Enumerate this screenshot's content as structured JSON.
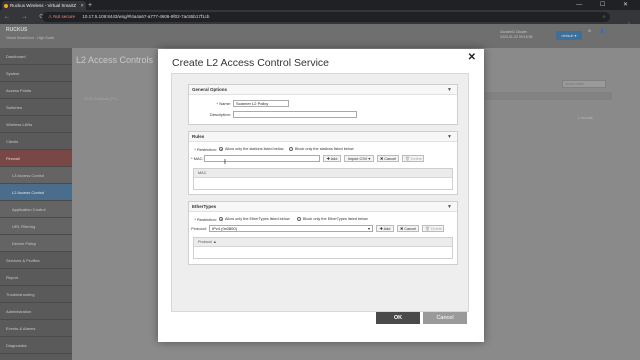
{
  "browser": {
    "tab_title": "Ruckus Wireless - Virtual SmartZ",
    "new_tab": "+",
    "window_controls": "— ☐ ✕",
    "nav": "← → ⟳",
    "not_secure": "⚠ Not secure",
    "url": "10.17.5.109:8443/wsg/#l4a4a67-a777-4606-9f02-7ac55b17f1cb"
  },
  "app": {
    "logo": "RUCKUS",
    "logo_sub": "Virtual SmartZone - High Scale",
    "cluster_lines": [
      "Cluster01 Cluster",
      "2020-01-22 09:16:35"
    ],
    "default_button": "default ▾",
    "header_icons": "⚙ 👤",
    "page_title": "L2 Access Controls",
    "search_placeholder": "search table",
    "tree_label": "SOS Controls (??)",
    "record_count": "1 records"
  },
  "sidebar": {
    "items": [
      {
        "label": "Dashboard"
      },
      {
        "label": "System"
      },
      {
        "label": "Access Points"
      },
      {
        "label": "Switches"
      },
      {
        "label": "Wireless LANs"
      },
      {
        "label": "Clients"
      },
      {
        "label": "Firewall"
      },
      {
        "label": "L3 Access Control"
      },
      {
        "label": "L2 Access Control"
      },
      {
        "label": "Application Control"
      },
      {
        "label": "URL Filtering"
      },
      {
        "label": "Device Policy"
      },
      {
        "label": "Services & Profiles"
      },
      {
        "label": "Report"
      },
      {
        "label": "Troubleshooting"
      },
      {
        "label": "Administration"
      },
      {
        "label": "Events & Alarms"
      },
      {
        "label": "Diagnostics"
      }
    ]
  },
  "modal": {
    "title": "Create L2 Access Control Service",
    "close": "✕",
    "general": {
      "header": "General Options",
      "name_label": "Name:",
      "name_value": "Scanner L2 Policy",
      "description_label": "Description:",
      "description_value": ""
    },
    "rules": {
      "header": "Rules",
      "restriction_label": "Restriction:",
      "allow_text": "Allow only the stations listed below",
      "block_text": "Block only the stations listed below",
      "mac_label": "MAC:",
      "mac_value": "",
      "add": "Add",
      "import_csv": "Import CSV ▾",
      "cancel": "Cancel",
      "delete": "Delete",
      "table_header": "MAC"
    },
    "ethertypes": {
      "header": "EtherTypes",
      "restriction_label": "Restriction:",
      "allow_text": "Allow only the EtherTypes listed below",
      "block_text": "Block only the EtherTypes listed below",
      "protocol_label": "Protocol:",
      "protocol_value": "IPv4 (0x0800)",
      "add": "Add",
      "cancel": "Cancel",
      "delete": "Delete",
      "table_header": "Protocol ▲"
    },
    "ok": "OK",
    "cancel": "Cancel"
  },
  "colors": {
    "firewall_active": "#7a4747",
    "selected_sub": "#4a6d8c",
    "ok_button": "#4a4a4a"
  }
}
